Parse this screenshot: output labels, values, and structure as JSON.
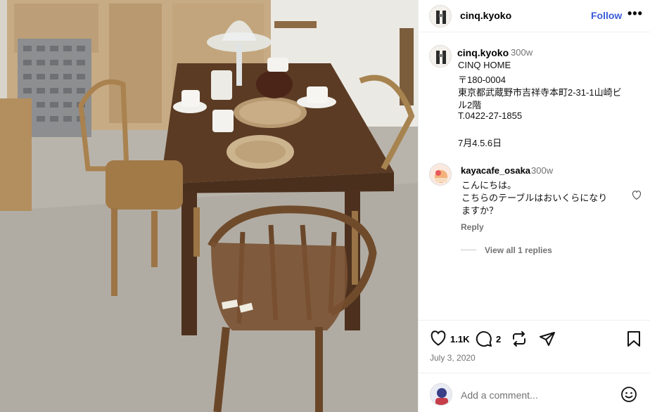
{
  "post": {
    "username": "cinq.kyoko",
    "follow_label": "Follow",
    "more_label": "•••"
  },
  "caption": {
    "username": "cinq.kyoko",
    "time": "300w",
    "lines": [
      "CINQ HOME",
      "〒180-0004",
      "東京都武蔵野市吉祥寺本町2-31-1山崎ビ",
      "ル2階",
      "T.0422-27-1855",
      "",
      "7月4.5.6日"
    ]
  },
  "comment": {
    "username": "kayacafe_osaka",
    "time": "300w",
    "lines": [
      "こんにちは。",
      "こちらのテーブルはおいくらになり",
      "ますか？"
    ],
    "reply_label": "Reply",
    "view_replies_label": "View all 1 replies"
  },
  "actions": {
    "like_count": "1.1K",
    "comment_count": "2",
    "date": "July 3, 2020"
  },
  "composer": {
    "placeholder": "Add a comment..."
  },
  "icons": [
    "avatar",
    "more-icon",
    "heart-icon",
    "comment-icon",
    "repost-icon",
    "share-icon",
    "bookmark-icon",
    "emoji-icon"
  ]
}
